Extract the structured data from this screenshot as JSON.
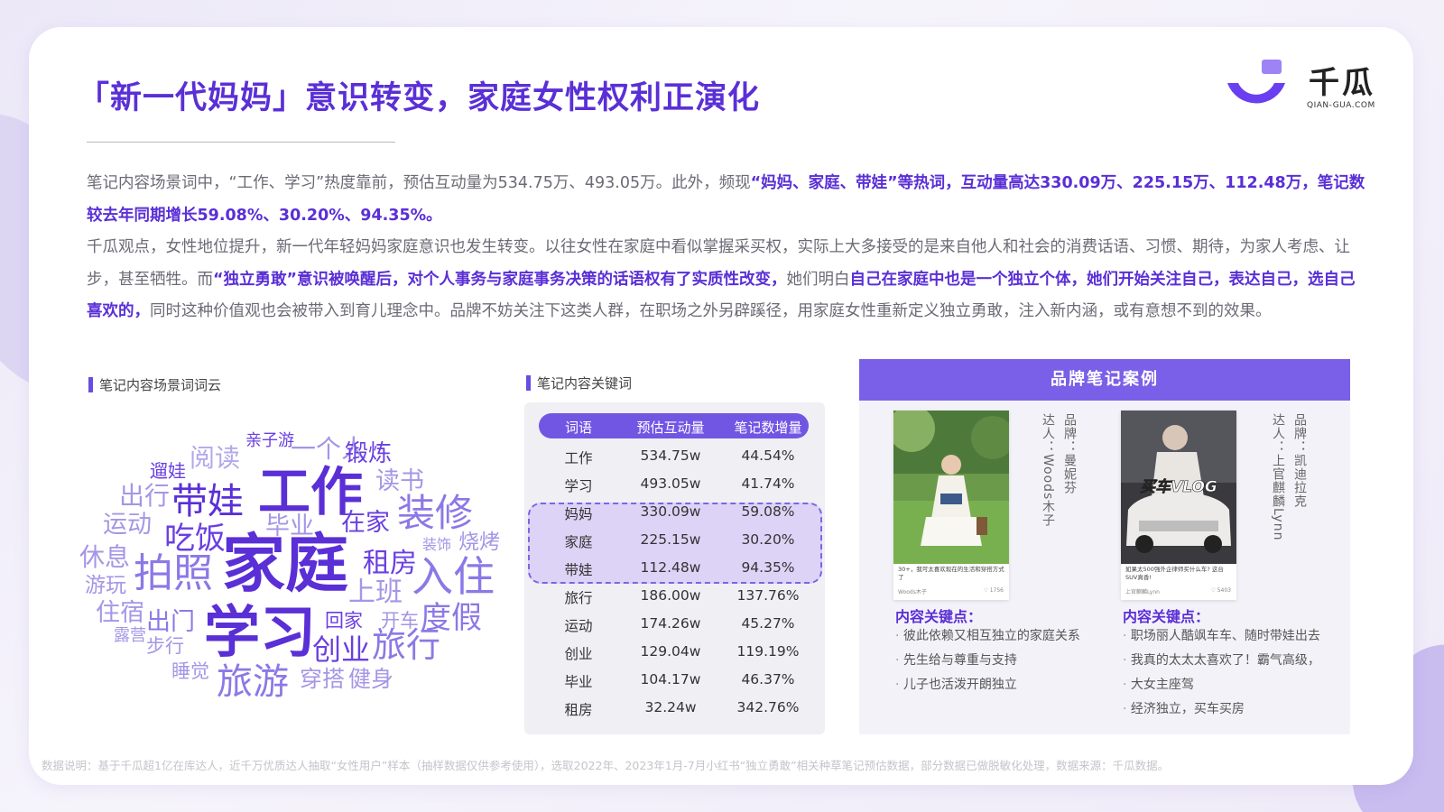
{
  "title": "「新一代妈妈」意识转变，家庭女性权利正演化",
  "logo": {
    "name": "千瓜",
    "sub": "QIAN-GUA.COM"
  },
  "para1": {
    "t1": "笔记内容场景词中，“工作、学习”热度靠前，预估互动量为534.75万、493.05万。此外，频现",
    "h1": "“妈妈、家庭、带娃”等热词，互动量高达330.09万、225.15万、112.48万，笔记数较去年同期增长59.08%、30.20%、94.35%。"
  },
  "para2": {
    "t1": "千瓜观点，女性地位提升，新一代年轻妈妈家庭意识也发生转变。以往女性在家庭中看似掌握采买权，实际上大多接受的是来自他人和社会的消费话语、习惯、期待，为家人考虑、让步，甚至牺牲。而",
    "h1": "“独立勇敢”意识被唤醒后，对个人事务与家庭事务决策的话语权有了实质性改变，",
    "t2": "她们明白",
    "h2": "自己在家庭中也是一个独立个体，她们开始关注自己，表达自己，选自己喜欢的，",
    "t3": "同时这种价值观也会被带入到育儿理念中。品牌不妨关注下这类人群，在职场之外另辟蹊径，用家庭女性重新定义独立勇敢，注入新内涵，或有意想不到的效果。"
  },
  "wordcloud": {
    "label": "笔记内容场景词词云",
    "words": [
      "亲子游",
      "一个人",
      "锻炼",
      "遛娃",
      "阅读",
      "读书",
      "出行",
      "带娃",
      "工作",
      "装修",
      "运动",
      "毕业",
      "在家",
      "吃饭",
      "装饰",
      "烧烤",
      "休息",
      "家庭",
      "租房",
      "拍照",
      "入住",
      "游玩",
      "上班",
      "住宿",
      "出门",
      "回家",
      "开车",
      "度假",
      "露营",
      "学习",
      "步行",
      "创业",
      "旅行",
      "睡觉",
      "旅游",
      "穿搭",
      "健身"
    ]
  },
  "keywords": {
    "label": "笔记内容关键词",
    "headers": [
      "词语",
      "预估互动量",
      "笔记数增量"
    ],
    "rows": [
      [
        "工作",
        "534.75w",
        "44.54%"
      ],
      [
        "学习",
        "493.05w",
        "41.74%"
      ],
      [
        "妈妈",
        "330.09w",
        "59.08%"
      ],
      [
        "家庭",
        "225.15w",
        "30.20%"
      ],
      [
        "带娃",
        "112.48w",
        "94.35%"
      ],
      [
        "旅行",
        "186.00w",
        "137.76%"
      ],
      [
        "运动",
        "174.26w",
        "45.27%"
      ],
      [
        "创业",
        "129.04w",
        "119.19%"
      ],
      [
        "毕业",
        "104.17w",
        "46.37%"
      ],
      [
        "租房",
        "32.24w",
        "342.76%"
      ]
    ]
  },
  "cases": {
    "header": "品牌笔记案例",
    "items": [
      {
        "brand": "品牌：曼妮芬",
        "kol": "达人：Woods木子",
        "caption": "30+，我可太喜欢现在的生活和穿搭方式了",
        "user": "Woods木子",
        "likes": "♡ 1756",
        "kp_title": "内容关键点：",
        "points": [
          "彼此依赖又相互独立的家庭关系",
          "先生给与尊重与支持",
          "儿子也活泼开朗独立"
        ]
      },
      {
        "brand": "品牌：凯迪拉克",
        "kol": "达人：上官麒麟Lynn",
        "caption": "如果太500强外企律师买什么车? 这台SUV真香!",
        "overlay": "买车VLOG",
        "user": "上官麒麟Lynn",
        "likes": "♡ 5403",
        "kp_title": "内容关键点：",
        "points": [
          "职场丽人酷飒车车、随时带娃出去",
          "我真的太太太喜欢了！霸气高级，",
          "大女主座驾",
          "经济独立，买车买房"
        ]
      }
    ]
  },
  "footnote": "数据说明：基于千瓜超1亿在库达人，近千万优质达人抽取“女性用户”样本（抽样数据仅供参考使用），选取2022年、2023年1月-7月小红书“独立勇敢”相关种草笔记预估数据，部分数据已做脱敏化处理，数据来源：千瓜数据。"
}
